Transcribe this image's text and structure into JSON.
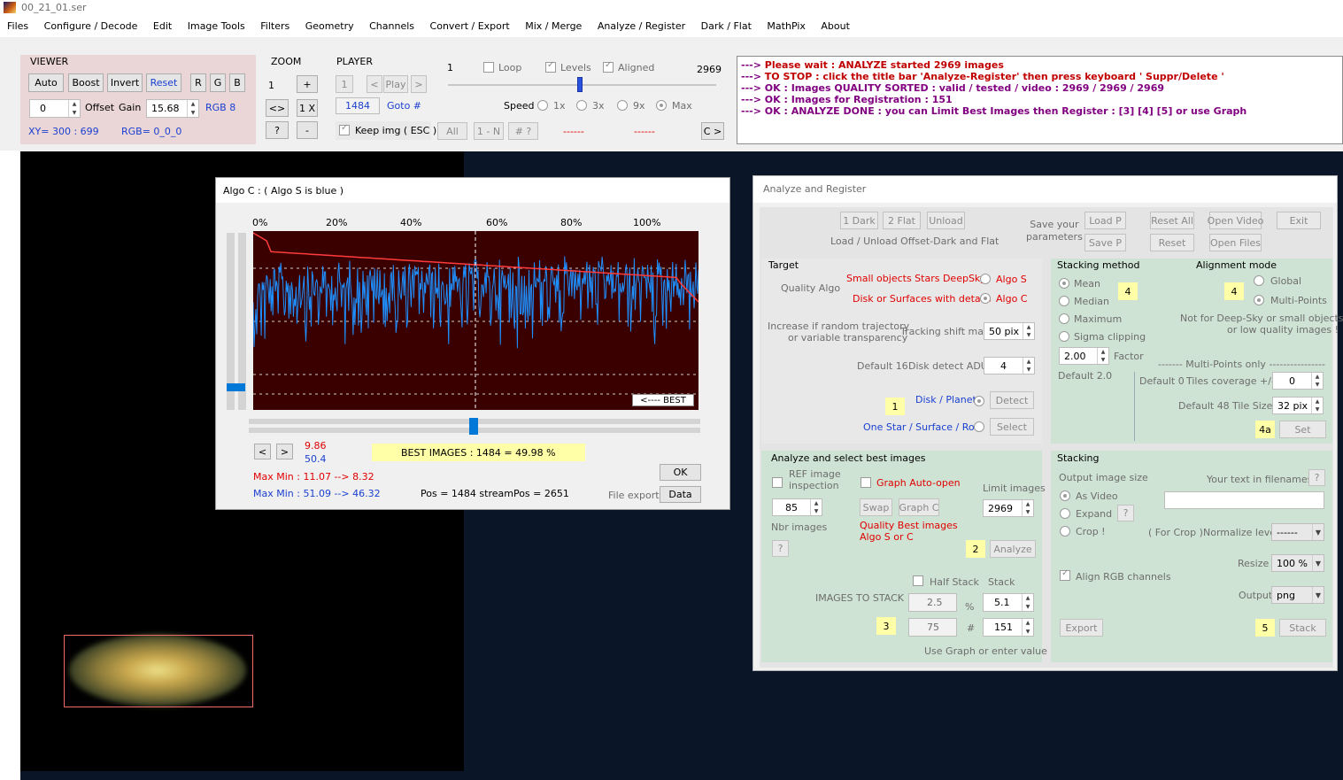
{
  "window": {
    "title": "00_21_01.ser"
  },
  "menu": [
    "Files",
    "Configure / Decode",
    "Edit",
    "Image Tools",
    "Filters",
    "Geometry",
    "Channels",
    "Convert / Export",
    "Mix / Merge",
    "Analyze / Register",
    "Dark / Flat",
    "MathPix",
    "About"
  ],
  "viewer": {
    "title": "VIEWER",
    "buttons": [
      "Auto",
      "Boost",
      "Invert",
      "Reset",
      "R",
      "G",
      "B"
    ],
    "offset_value": "0",
    "offset_label": "Offset",
    "gain_label": "Gain",
    "gain_value": "15.68",
    "rgb_mode": "RGB 8",
    "xy": "XY=  300 : 699",
    "rgb": "RGB=  0_0_0"
  },
  "zoom": {
    "title": "ZOOM",
    "value": "1",
    "buttons": [
      "+",
      "<>",
      "1 X",
      "?",
      "-"
    ]
  },
  "player": {
    "title": "PLAYER",
    "frame_start": "1",
    "frame_end": "2969",
    "loop_label": "Loop",
    "levels_label": "Levels",
    "aligned_label": "Aligned",
    "btn_first": "1",
    "btn_prev": "<",
    "btn_play": "Play",
    "btn_next": ">",
    "current_frame": "1484",
    "goto_label": "Goto #",
    "speed_label": "Speed",
    "speeds": [
      "1x",
      "3x",
      "9x",
      "Max"
    ],
    "keep_img": "Keep img ( ESC )",
    "btn_all": "All",
    "btn_1n": "1 - N",
    "btn_hash": "# ?",
    "dash1": "------",
    "dash2": "------",
    "btn_c": "C >"
  },
  "log": [
    {
      "arrow": "--->",
      "text": "Please wait :   ANALYZE started    2969 images",
      "color": "#c00000"
    },
    {
      "arrow": "--->",
      "text": "TO STOP :   click the title bar  'Analyze-Register' then press keyboard ' Suppr/Delete '",
      "color": "#c00000"
    },
    {
      "arrow": "--->",
      "text": "OK :   Images  QUALITY SORTED :    valid / tested / video  :   2969  /  2969  /  2969",
      "color": "#800080"
    },
    {
      "arrow": "--->",
      "text": "OK :   Images for Registration :   151",
      "color": "#800080"
    },
    {
      "arrow": "--->",
      "text": "OK :   ANALYZE DONE : you can Limit Best Images then Register :  [3]  [4]  [5]   or use Graph",
      "color": "#800080"
    }
  ],
  "graph_window": {
    "title": "Algo C :   ( Algo S is blue )",
    "percent_labels": [
      "0%",
      "20%",
      "40%",
      "60%",
      "80%",
      "100%"
    ],
    "best_label": "<---- BEST",
    "btn_prev": "<",
    "btn_next": ">",
    "val_red": "9.86",
    "val_blue": "50.4",
    "best_images": "BEST IMAGES :    1484  =  49.98 %",
    "maxmin_red": "Max Min :  11.07  --> 8.32",
    "maxmin_blue": "Max Min :  51.09  -->  46.32",
    "pos": "Pos =  1484   streamPos = 2651",
    "btn_ok": "OK",
    "file_export": "File export",
    "btn_data": "Data"
  },
  "ar": {
    "title": "Analyze and Register",
    "top_buttons": [
      "1  Dark",
      "2  Flat",
      "Unload"
    ],
    "load_unload_label": "Load / Unload Offset-Dark and Flat",
    "save_params": "Save your\nparameters",
    "btn_loadp": "Load P",
    "btn_savep": "Save P",
    "btn_resetall": "Reset All",
    "btn_reset": "Reset",
    "btn_openvideo": "Open Video",
    "btn_openfiles": "Open Files",
    "btn_exit": "Exit",
    "target": {
      "title": "Target",
      "quality_algo": "Quality Algo",
      "small_objects": "Small objects  Stars  DeepSky",
      "algo_s": "Algo S",
      "disk_surfaces": "Disk or Surfaces with details",
      "algo_c": "Algo C",
      "increase_1": "Increase if random trajectory",
      "increase_2": "or variable transparency",
      "tracking_label": "Tracking shift max",
      "tracking_value": "50 pix",
      "default16": "Default 16",
      "disk_detect": "Disk detect ADU",
      "disk_detect_value": "4",
      "badge1": "1",
      "disk_planet": "Disk / Planet",
      "btn_detect": "Detect",
      "one_star": "One Star / Surface  /  Roi",
      "btn_select": "Select"
    },
    "stacking_method": {
      "title": "Stacking method",
      "options": [
        "Mean",
        "Median",
        "Maximum",
        "Sigma clipping"
      ],
      "badge4": "4",
      "factor_value": "2.00",
      "factor_label": "Factor",
      "default": "Default 2.0"
    },
    "alignment": {
      "title": "Alignment mode",
      "badge4": "4",
      "global": "Global",
      "multipoints": "Multi-Points",
      "note1": "Not for Deep-Sky or small objects",
      "note2": "or low quality images !",
      "mp_only": "-------  Multi-Points only  ----------------",
      "default0": "Default 0",
      "tiles_cov": "Tiles coverage +/-",
      "tiles_cov_value": "0",
      "default48": "Default 48",
      "tile_size": "Tile Size",
      "tile_size_value": "32 pix",
      "badge4a": "4a",
      "btn_set": "Set"
    },
    "analyze": {
      "title": "Analyze and select best images",
      "ref_image": "REF image",
      "inspection": "inspection",
      "graph_auto": "Graph Auto-open",
      "limit_images": "Limit images",
      "ref_value": "85",
      "btn_swap": "Swap",
      "btn_graphc": "Graph C",
      "limit_value": "2969",
      "nbr_images": "Nbr images",
      "quality_best": "Quality Best images",
      "algo_sc": "Algo S or C",
      "btn_q": "?",
      "badge2": "2",
      "btn_analyze": "Analyze",
      "half_stack": "Half Stack",
      "stack": "Stack",
      "images_to_stack": "IMAGES TO STACK",
      "pct_half": "2.5",
      "pct": "%",
      "pct_stack": "5.1",
      "badge3": "3",
      "num_half": "75",
      "hash": "#",
      "num_stack": "151",
      "use_graph": "Use Graph or enter value"
    },
    "stacking": {
      "title": "Stacking",
      "output_size": "Output  image size",
      "your_text": "Your text in filenames",
      "btn_q": "?",
      "as_video": "As Video",
      "expand": "Expand",
      "btn_q2": "?",
      "crop": "Crop !",
      "for_crop": "( For Crop )",
      "normalize": "Normalize level",
      "normalize_value": "------",
      "resize": "Resize",
      "resize_value": "100 %",
      "align_rgb": "Align RGB channels",
      "output": "Output",
      "output_value": "png",
      "btn_export": "Export",
      "badge5": "5",
      "btn_stack": "Stack"
    }
  }
}
